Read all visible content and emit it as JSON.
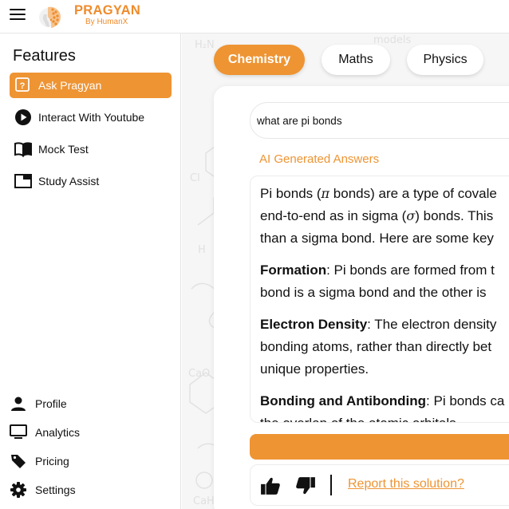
{
  "brand": {
    "name": "PRAGYAN",
    "subtitle": "By HumanX"
  },
  "sidebar": {
    "title": "Features",
    "items": [
      {
        "label": "Ask Pragyan",
        "icon": "help-icon",
        "active": true
      },
      {
        "label": "Interact With Youtube",
        "icon": "play-circle-icon"
      },
      {
        "label": "Mock Test",
        "icon": "book-icon"
      },
      {
        "label": "Study Assist",
        "icon": "window-icon"
      }
    ],
    "bottom_items": [
      {
        "label": "Profile",
        "icon": "person-icon"
      },
      {
        "label": "Analytics",
        "icon": "monitor-icon"
      },
      {
        "label": "Pricing",
        "icon": "tag-icon"
      },
      {
        "label": "Settings",
        "icon": "gear-icon"
      }
    ]
  },
  "tabs": [
    {
      "label": "Chemistry",
      "active": true
    },
    {
      "label": "Maths"
    },
    {
      "label": "Physics"
    }
  ],
  "query": {
    "value": "what are pi bonds"
  },
  "answer": {
    "title": "AI Generated Answers",
    "p1_a": "Pi bonds (",
    "p1_pi": "π",
    "p1_b": " bonds) are a type of covale",
    "p1_c": "end-to-end as in sigma (",
    "p1_sigma": "σ",
    "p1_d": ") bonds. This",
    "p1_e": "than a sigma bond. Here are some key",
    "p2_head": "Formation",
    "p2_a": ": Pi bonds are formed from t",
    "p2_b": "bond is a sigma bond and the other is",
    "p3_head": "Electron Density",
    "p3_a": ": The electron density",
    "p3_b": "bonding atoms, rather than directly bet",
    "p3_c": "unique properties.",
    "p4_head": "Bonding and Antibonding",
    "p4_a": ": Pi bonds ca",
    "p4_b": "the overlap of the atomic orbitals"
  },
  "feedback": {
    "report_label": "Report this solution?"
  },
  "colors": {
    "accent": "#ee9433",
    "brand": "#ee8c2c"
  }
}
